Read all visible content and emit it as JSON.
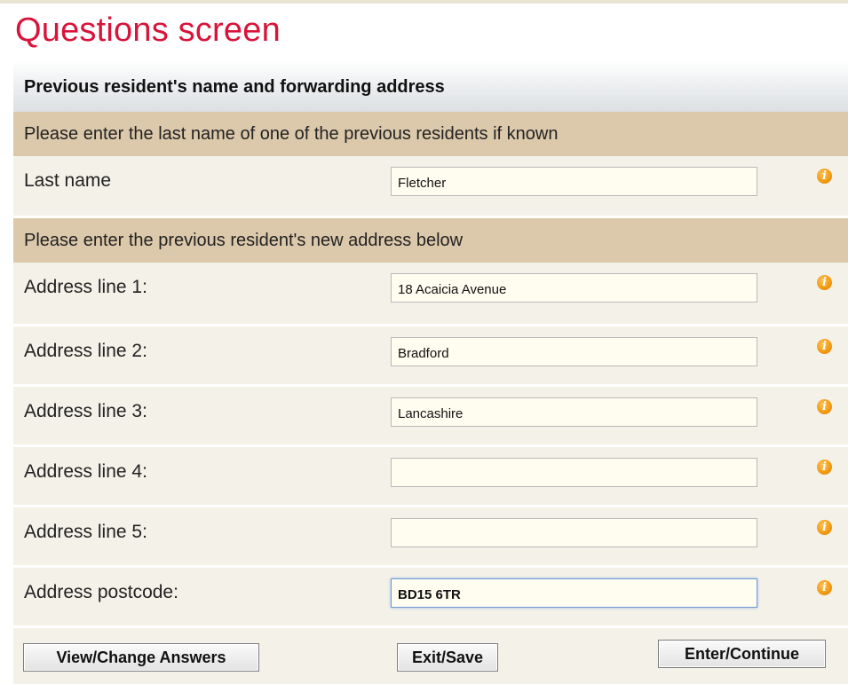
{
  "page": {
    "title": "Questions screen"
  },
  "section": {
    "title": "Previous resident's name and forwarding address"
  },
  "instructions": {
    "last_name": "Please enter the last name of one of the previous residents if known",
    "address": "Please enter the previous resident's new address below"
  },
  "fields": [
    {
      "label": "Last name",
      "value": "Fletcher",
      "icon": "info-icon"
    },
    {
      "label": "Address line 1:",
      "value": "18 Acaicia Avenue",
      "icon": "info-icon"
    },
    {
      "label": "Address line 2:",
      "value": "Bradford",
      "icon": "info-icon"
    },
    {
      "label": "Address line 3:",
      "value": "Lancashire",
      "icon": "info-icon"
    },
    {
      "label": "Address line 4:",
      "value": "",
      "icon": "info-icon"
    },
    {
      "label": "Address line 5:",
      "value": "",
      "icon": "info-icon"
    },
    {
      "label": "Address postcode:",
      "value": "BD15 6TR",
      "icon": "info-icon"
    }
  ],
  "buttons": {
    "view_change": "View/Change Answers",
    "exit_save": "Exit/Save",
    "enter_continue": "Enter/Continue"
  },
  "colors": {
    "title": "#d9143a",
    "instruction_band": "#dcc9ab",
    "panel": "#f4f1e9",
    "info_icon": "#f39c12"
  }
}
